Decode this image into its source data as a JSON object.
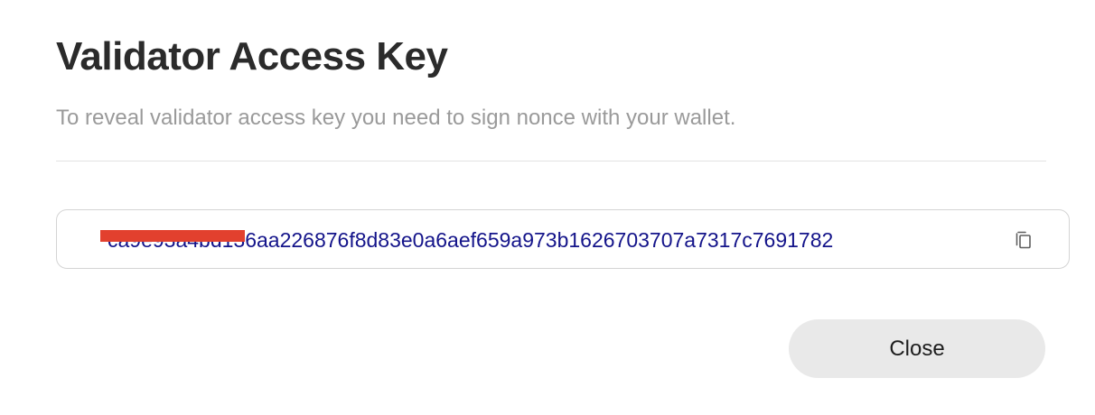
{
  "dialog": {
    "title": "Validator Access Key",
    "subtitle": "To reveal validator access key you need to sign nonce with your wallet.",
    "access_key": {
      "value": "ca9e93a4bd136aa226876f8d83e0a6aef659a973b1626703707a7317c7691782",
      "text_color": "#14148a",
      "redaction_color": "#e2402e"
    },
    "copy_icon": "copy-icon",
    "close_label": "Close"
  }
}
